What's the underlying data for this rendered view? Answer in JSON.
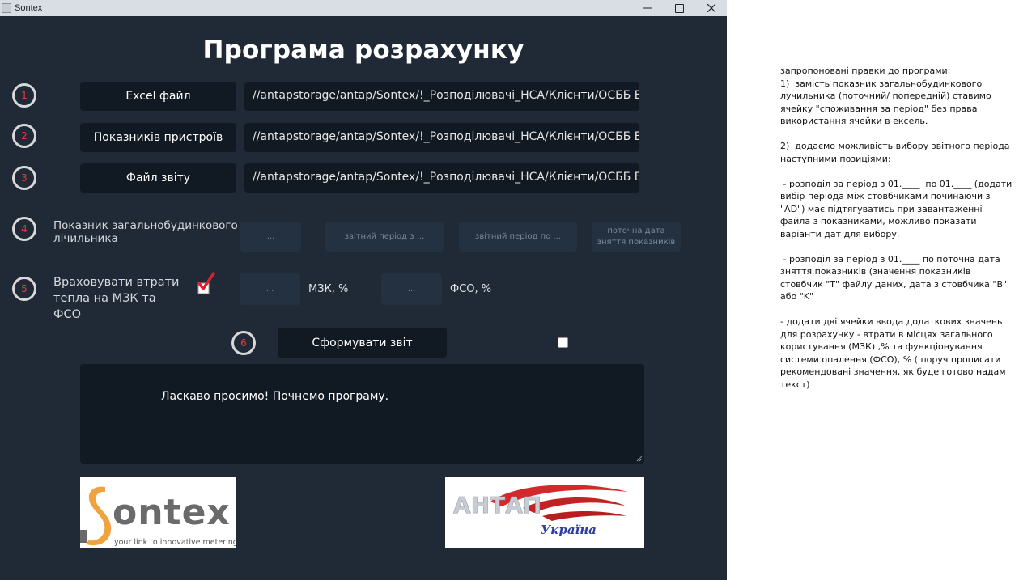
{
  "window": {
    "title": "Sontex"
  },
  "main": {
    "title": "Програма розрахунку"
  },
  "steps": [
    "1",
    "2",
    "3",
    "4",
    "5",
    "6"
  ],
  "files": [
    {
      "button_label": "Excel файл",
      "path": "//antapstorage/antap/Sontex/!_Розподілювачі_НСА/Клієнти/ОСББ Вишня/С"
    },
    {
      "button_label": "Показників пристроїв",
      "path": "//antapstorage/antap/Sontex/!_Розподілювачі_НСА/Клієнти/ОСББ Вишня/п"
    },
    {
      "button_label": "Файл звіту",
      "path": "//antapstorage/antap/Sontex/!_Розподілювачі_НСА/Клієнти/ОСББ Вишня/З"
    }
  ],
  "meter": {
    "label": "Показник загальнобудинкового лічильника",
    "fields": [
      "...",
      "звітний період з ...",
      "звітний період по ...",
      "поточна дата зняття показників"
    ]
  },
  "losses": {
    "label": "Враховувати втрати тепла на МЗК та ФСО",
    "checked": true,
    "mzk_value": "...",
    "mzk_label": "МЗК, %",
    "fso_value": "...",
    "fso_label": "ФСО, %"
  },
  "generate": {
    "button_label": "Сформувати звіт",
    "checkbox_checked": false
  },
  "log": {
    "text": "Ласкаво просимо! Почнемо програму."
  },
  "logos": {
    "sontex_text": "ontex",
    "sontex_tagline": "your link to innovative metering",
    "antap_text": "АНТАП",
    "antap_sub": "Україна"
  },
  "notes": [
    "запропоновані правки до програми:",
    "1)  замість показник загальнобудинкового лучильника (поточний/ попередній) ставимо ячейку \"споживання за період\" без права використання ячейки в ексель.",
    "",
    "2)  додаємо можливість вибору звітного періода наступними позиціями:",
    "",
    " - розподіл за період з 01.____  по 01.____ (додати вибір періода між стовбчиками починаючи з \"AD\") має підтягуватись при завантаженні файла з показниками, можливо показати варіанти дат для вибору.",
    "",
    " - розподіл за період з 01.____ по поточна дата зняття показників (значення показників стовбчик \"T\" файлу даних, дата з стовбчика \"B\" або \"K\"",
    "",
    "- додати дві ячейки ввода додаткових значень для розрахунку - втрати в місцях загального користування (МЗК) ,% та функціонування системи опалення (ФСО), % ( поруч прописати рекомендовані значення, як буде готово надам текст)"
  ],
  "colors": {
    "window_bg": "#1f2a36",
    "button_bg": "#111922",
    "step_number": "#e5383b",
    "check_red": "#e0202c"
  }
}
